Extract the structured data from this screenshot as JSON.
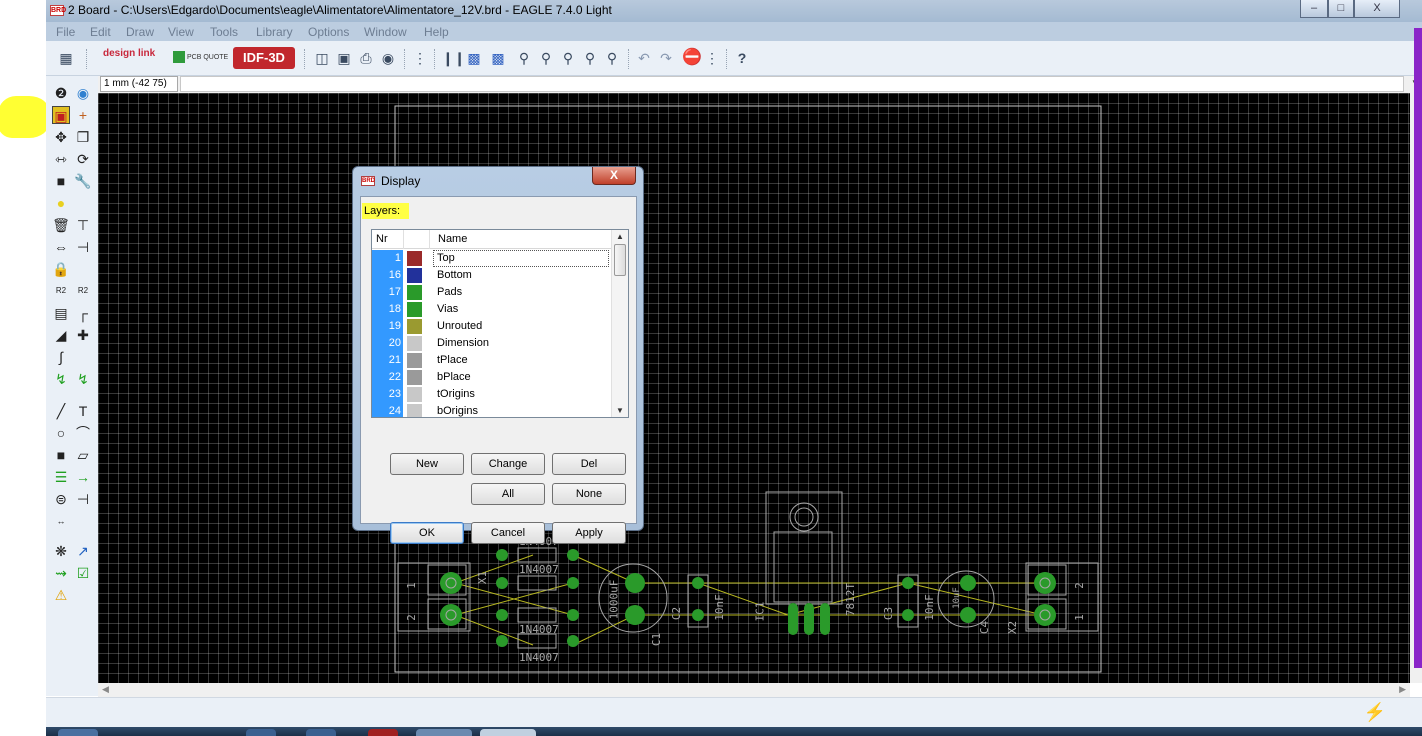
{
  "window": {
    "title": "2 Board - C:\\Users\\Edgardo\\Documents\\eagle\\Alimentatore\\Alimentatore_12V.brd - EAGLE 7.4.0 Light",
    "app_icon_text": "BRD",
    "minimize": "–",
    "maximize": "□",
    "close": "X"
  },
  "menu": [
    "File",
    "Edit",
    "Draw",
    "View",
    "Tools",
    "Library",
    "Options",
    "Window",
    "Help"
  ],
  "toolbar": {
    "designlink_label": "design link",
    "pcb_quote_label": "PCB QUOTE",
    "idf3d_label": "IDF-3D"
  },
  "coord": {
    "display": "1 mm (-42 75)",
    "command_placeholder": ""
  },
  "dialog": {
    "title": "Display",
    "icon_text": "BRD",
    "close_label": "X",
    "layers_label": "Layers:",
    "header_nr": "Nr",
    "header_name": "Name",
    "layers": [
      {
        "nr": "1",
        "name": "Top",
        "color": "#9a2a2a"
      },
      {
        "nr": "16",
        "name": "Bottom",
        "color": "#22319b"
      },
      {
        "nr": "17",
        "name": "Pads",
        "color": "#2a9a2a"
      },
      {
        "nr": "18",
        "name": "Vias",
        "color": "#2a9a2a"
      },
      {
        "nr": "19",
        "name": "Unrouted",
        "color": "#9a9a30"
      },
      {
        "nr": "20",
        "name": "Dimension",
        "color": "#c8c8c8"
      },
      {
        "nr": "21",
        "name": "tPlace",
        "color": "#9a9a9a"
      },
      {
        "nr": "22",
        "name": "bPlace",
        "color": "#9a9a9a"
      },
      {
        "nr": "23",
        "name": "tOrigins",
        "color": "#c8c8c8"
      },
      {
        "nr": "24",
        "name": "bOrigins",
        "color": "#c8c8c8"
      }
    ],
    "buttons": {
      "new": "New",
      "change": "Change",
      "del": "Del",
      "all": "All",
      "none": "None",
      "ok": "OK",
      "cancel": "Cancel",
      "apply": "Apply"
    }
  },
  "board": {
    "labels": {
      "d1": "1N4007",
      "d2": "1N4007",
      "d3": "1N4007",
      "d4": "1N4007",
      "x1": "X1",
      "x2": "X2",
      "c1": "C1",
      "c1_val": "1000uF",
      "c2": "C2",
      "c2_val": "10nF",
      "ic1": "IC1",
      "ic1_val": "7812T",
      "c3": "C3",
      "c3_val": "10nF",
      "c4": "C4",
      "c4_val": "10uF",
      "pin1_left": "1",
      "pin2_left": "2",
      "pin1_right": "1",
      "pin2_right": "2"
    }
  }
}
